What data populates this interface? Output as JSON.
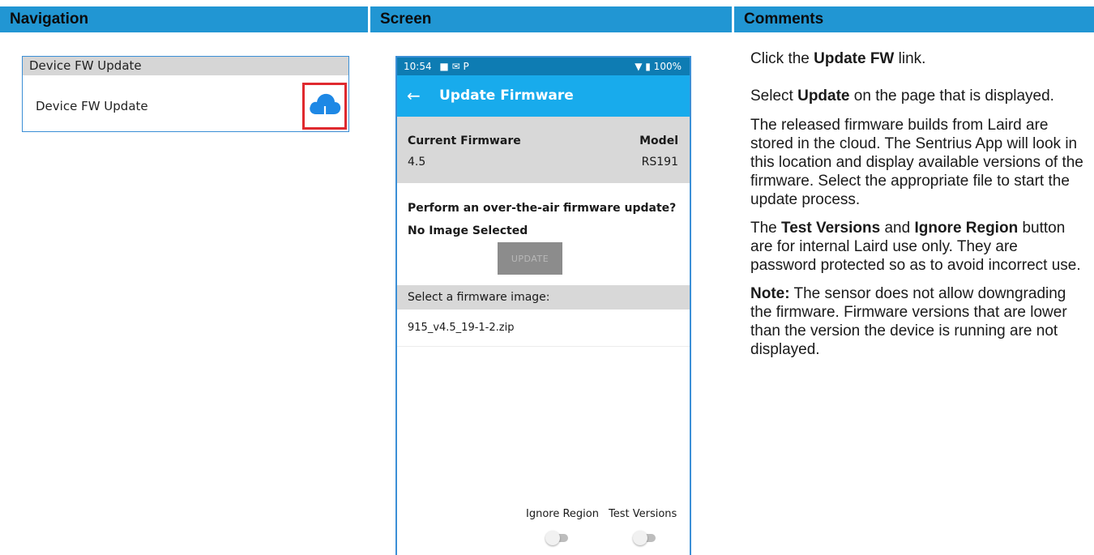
{
  "header": {
    "navigation": "Navigation",
    "screen": "Screen",
    "comments": "Comments"
  },
  "navigation": {
    "section_title": "Device FW Update",
    "item_label": "Device FW Update",
    "item_icon": "cloud-download-icon"
  },
  "phone": {
    "status_time": "10:54",
    "status_icons": "■ ✉ P",
    "status_right": "▼ ▮ 100%",
    "app_title": "Update Firmware",
    "current_firmware_label": "Current Firmware",
    "current_firmware_value": "4.5",
    "model_label": "Model",
    "model_value": "RS191",
    "ota_question": "Perform an over-the-air firmware update?",
    "image_status": "No Image Selected",
    "update_button": "UPDATE",
    "select_header": "Select a firmware image:",
    "firmware_files": [
      "915_v4.5_19-1-2.zip"
    ],
    "ignore_region_label": "Ignore Region",
    "test_versions_label": "Test Versions",
    "ignore_region_on": false,
    "test_versions_on": false
  },
  "comments": {
    "p1_pre": "Click the ",
    "p1_bold": "Update FW",
    "p1_post": " link.",
    "p2_pre": "Select ",
    "p2_bold": "Update",
    "p2_post": " on the page that is displayed.",
    "p3": "The released firmware builds from Laird are stored in the cloud. The Sentrius App will look in this location and display available versions of the firmware. Select the appropriate file to start the update process.",
    "p4_pre": "The ",
    "p4_bold1": "Test Versions",
    "p4_mid": " and ",
    "p4_bold2": "Ignore Region",
    "p4_post": " button are for internal Laird use only. They are password protected so as to avoid incorrect use.",
    "p5_bold": "Note:",
    "p5_post": " The sensor does not allow downgrading the firmware. Firmware versions that are lower than the version the device is running are not displayed."
  },
  "colors": {
    "header_blue": "#2196d3",
    "status_bar": "#0e7cb3",
    "app_bar": "#18abec",
    "highlight_red": "#e0292e",
    "cloud_blue": "#1e88e5"
  }
}
